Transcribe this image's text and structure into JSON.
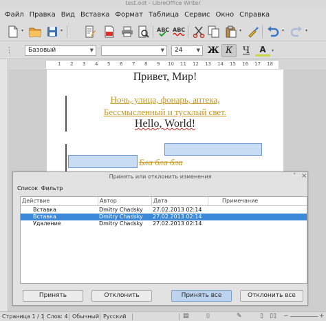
{
  "window": {
    "title": "test.odt - LibreOffice Writer"
  },
  "menu": [
    "Файл",
    "Правка",
    "Вид",
    "Вставка",
    "Формат",
    "Таблица",
    "Сервис",
    "Окно",
    "Справка"
  ],
  "menu_underline": [
    "Ф",
    "П",
    "В",
    "с",
    "о",
    "Т",
    "С",
    "О",
    "С"
  ],
  "toolbar": {
    "icons": [
      "new-document",
      "open-folder",
      "save",
      "edit-document",
      "export-pdf",
      "print",
      "page-preview",
      "spellcheck",
      "autospellcheck",
      "cut",
      "copy",
      "paste",
      "clone-formatting",
      "undo",
      "redo"
    ]
  },
  "formatting": {
    "style": "Базовый",
    "font": "",
    "size": "24",
    "bold": "Ж",
    "italic": "К",
    "underline": "Ч",
    "fontcolor": "A"
  },
  "ruler_numbers": [
    "1",
    "2",
    "3",
    "4",
    "5",
    "6",
    "7",
    "8",
    "9",
    "10",
    "11",
    "12",
    "13",
    "14",
    "15",
    "16",
    "17",
    "18"
  ],
  "document": {
    "line1": "Привет, Мир!",
    "line2": "Ночь, улица, фонарь, аптека,",
    "line3": "Бессмысленный и тусклый свет.",
    "line4": "Hello, World!",
    "line5": "Бла бла бла",
    "change_color": "#c8951e"
  },
  "dialog": {
    "title": "Принять или отклонить изменения",
    "tabs": [
      "Список",
      "Фильтр"
    ],
    "columns": [
      "Действие",
      "Автор",
      "Дата",
      "Примечание"
    ],
    "rows": [
      {
        "action": "Вставка",
        "author": "Dmitry Chadsky",
        "date": "27.02.2013 02:14",
        "note": ""
      },
      {
        "action": "Вставка",
        "author": "Dmitry Chadsky",
        "date": "27.02.2013 02:14",
        "note": ""
      },
      {
        "action": "Удаление",
        "author": "Dmitry Chadsky",
        "date": "27.02.2013 02:14",
        "note": ""
      }
    ],
    "selected_row": 1,
    "buttons": {
      "accept": "Принять",
      "reject": "Отклонить",
      "accept_all": "Принять все",
      "reject_all": "Отклонить все"
    }
  },
  "status": {
    "page": "Страница 1 / 1",
    "words": "Слов: 4",
    "style": "Обычный",
    "language": "Русский"
  },
  "colors": {
    "selection": "#3b88d8",
    "accent": "#c8951e",
    "frame": "#c8dcf4"
  }
}
